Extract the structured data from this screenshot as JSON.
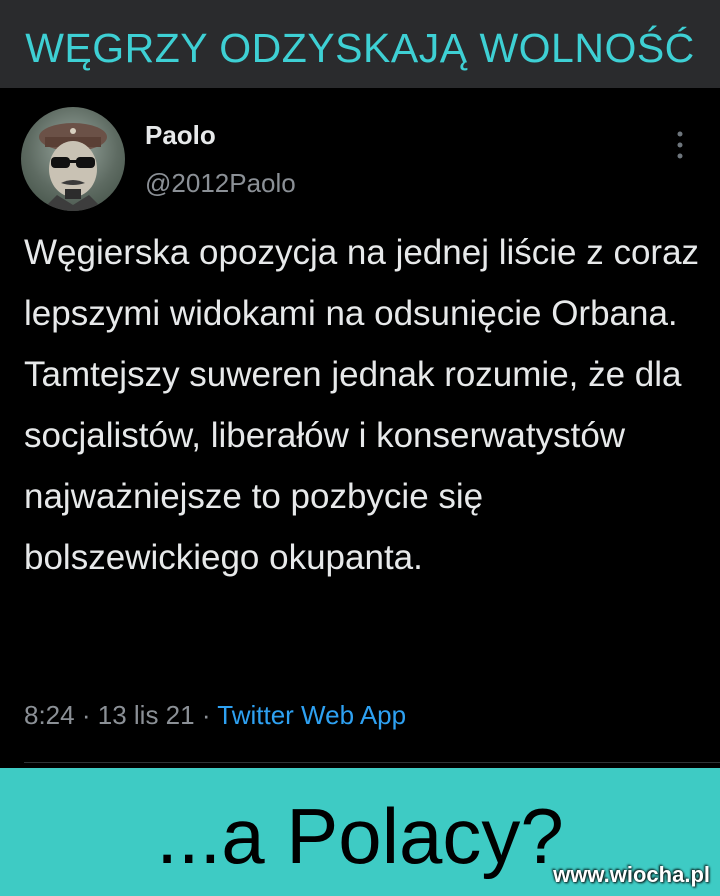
{
  "header": {
    "title": "WĘGRZY ODZYSKAJĄ WOLNOŚĆ"
  },
  "tweet": {
    "user_name": "Paolo",
    "user_handle": "@2012Paolo",
    "text": "Węgierska opozycja na jednej liście z coraz lepszymi widokami na odsunięcie Orbana. Tamtejszy suweren jednak rozumie, że dla socjalistów, liberałów i konserwatystów najważniejsze to pozbycie się bolszewickiego okupanta.",
    "time": "8:24",
    "date": "13 lis 21",
    "source_app": "Twitter Web App",
    "separator": "·"
  },
  "footer": {
    "caption": "...a Polacy?",
    "watermark": "www.wiocha.pl"
  },
  "colors": {
    "header_background": "#2a2b2d",
    "header_text": "#3ed0d4",
    "tweet_background": "#000000",
    "link_blue": "#2ea1f2",
    "footer_background": "#3ecbc4"
  },
  "icons": {
    "avatar": "avatar-image",
    "more": "more-options-icon"
  }
}
